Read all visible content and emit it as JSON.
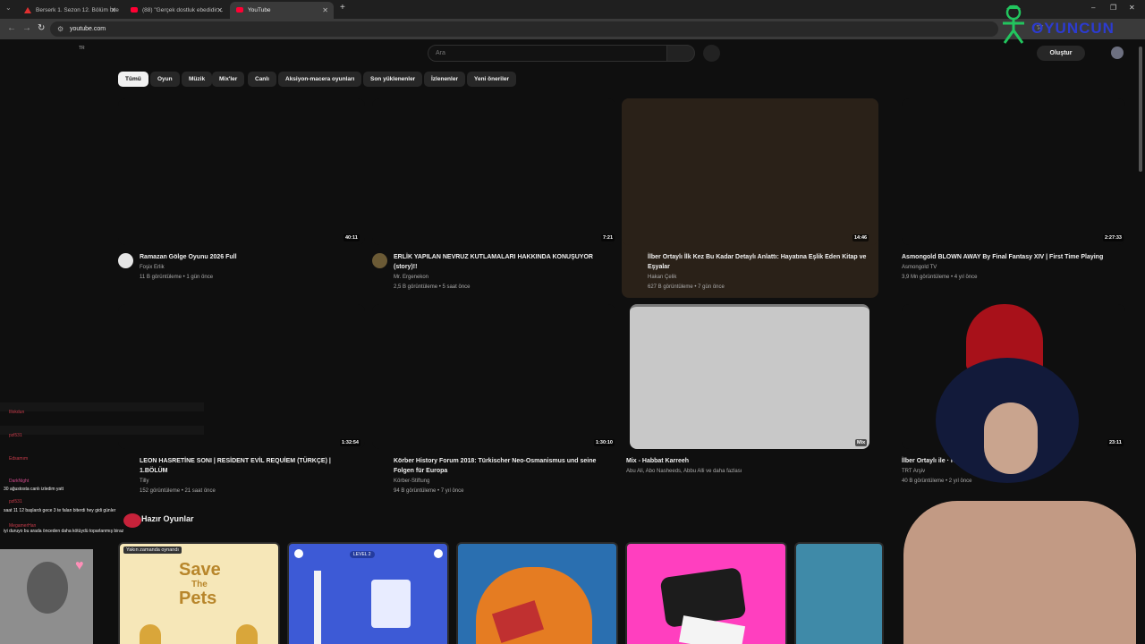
{
  "browser": {
    "tabs": [
      {
        "title": "Berserk 1. Sezon 12. Bölüm İzle",
        "icon": "warning-triangle-icon"
      },
      {
        "title": "(88) \"Gerçek dostluk ebedidir…",
        "icon": "youtube-icon"
      },
      {
        "title": "YouTube",
        "icon": "youtube-icon"
      }
    ],
    "url": "youtube.com"
  },
  "header": {
    "lang_badge": "TR",
    "search_placeholder": "Ara",
    "create_label": "Oluştur"
  },
  "chips": [
    "Tümü",
    "Oyun",
    "Müzik",
    "Mix'ler",
    "Canlı",
    "Aksiyon-macera oyunları",
    "Son yüklenenler",
    "İzlenenler",
    "Yeni öneriler"
  ],
  "videos": [
    {
      "title": "Ramazan Gölge Oyunu 2026 Full",
      "channel": "Foşix Erlik",
      "meta": "11 B görüntüleme • 1 gün önce",
      "duration": "40:11"
    },
    {
      "title": "ERLİK YAPILAN NEVRUZ KUTLAMALARI HAKKINDA KONUŞUYOR (story)!!",
      "channel": "Mr. Ergenekon",
      "meta": "2,5 B görüntüleme • 5 saat önce",
      "duration": "7:21"
    },
    {
      "title": "İlber Ortaylı İlk Kez Bu Kadar Detaylı Anlattı: Hayatına Eşlik Eden Kitap ve Eşyalar",
      "channel": "Hakan Çelik",
      "meta": "627 B görüntüleme • 7 gün önce",
      "duration": "14:46"
    },
    {
      "title": "Asmongold BLOWN AWAY By Final Fantasy XIV | First Time Playing",
      "channel": "Asmongold TV",
      "meta": "3,9 Mn görüntüleme • 4 yıl önce",
      "duration": "2:27:33"
    },
    {
      "title": "LEON HASRETİNE SONI | RESİDENT EVİL REQUİEM (TÜRKÇE) | 1.BÖLÜM",
      "channel": "Tilly",
      "meta": "152 görüntüleme • 21 saat önce",
      "duration": "1:32:54"
    },
    {
      "title": "Körber History Forum 2018: Türkischer Neo-Osmanismus und seine Folgen für Europa",
      "channel": "Körber-Stiftung",
      "meta": "94 B görüntüleme • 7 yıl önce",
      "duration": "1:30:10"
    },
    {
      "title": "Mix - Habbat Karreeh",
      "channel": "Abu Ali, Abo Nasheeds, Abbu Alli ve daha fazlası",
      "meta": "",
      "duration": "Mix"
    },
    {
      "title": "İlber Ortaylı ile · Kıraç · … TRT Arşiv",
      "channel": "TRT Arşiv",
      "meta": "40 B görüntüleme • 2 yıl önce",
      "duration": "23:11"
    }
  ],
  "games": {
    "section_title": "Hazır Oyunlar",
    "recent_badge": "Yakın zamanda oynandı",
    "level_badge": "LEVEL 2",
    "items": [
      {
        "title_line1": "Save",
        "title_line2": "The",
        "title_line3": "Pets"
      }
    ]
  },
  "chat": [
    {
      "name": "Illokdun",
      "text": ""
    },
    {
      "name": "pzl531",
      "text": ""
    },
    {
      "name": "Edsamım",
      "text": ""
    },
    {
      "name": "DarkNight",
      "text": "30 ağustosta canlı izledim yatt"
    },
    {
      "name": "pzl531",
      "text": "saat 11 12 başlardı gece 3 te falan biterdi hey gidi günler"
    },
    {
      "name": "MegamerHan",
      "text": "iyi duruyo bu arada önceden daha kötüydü toparlanmış biraz"
    }
  ],
  "overlay": {
    "brand": "OYUNCUN"
  },
  "colors": {
    "background": "#0f0f0f",
    "chip_active": "#f1f1f1",
    "chip": "#272727",
    "accent_red": "#ff0033"
  }
}
